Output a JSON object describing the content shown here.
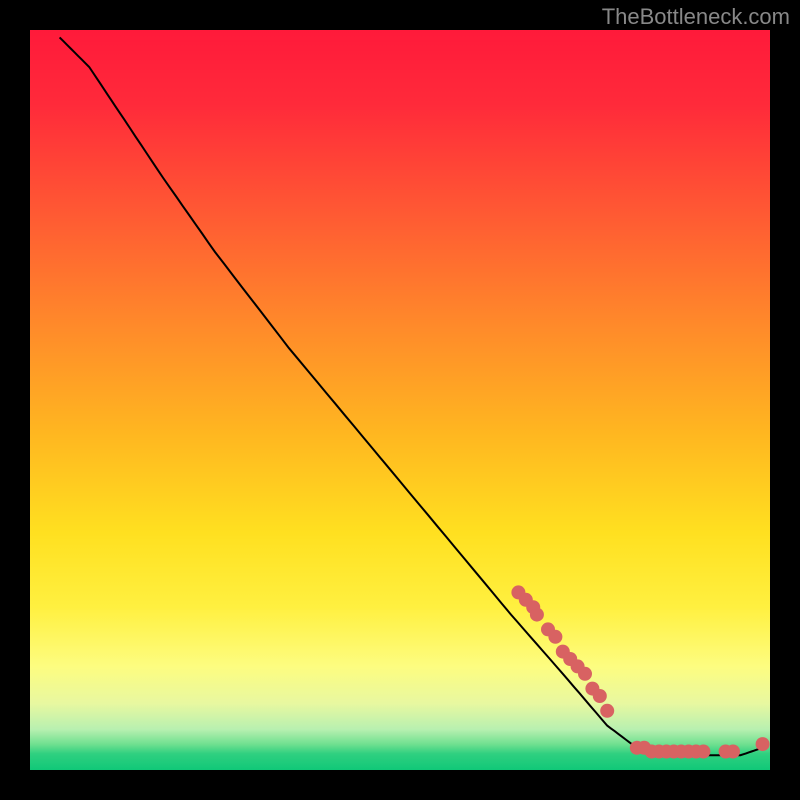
{
  "watermark": "TheBottleneck.com",
  "chart_data": {
    "type": "line",
    "title": "",
    "xlabel": "",
    "ylabel": "",
    "xlim": [
      0,
      100
    ],
    "ylim": [
      0,
      100
    ],
    "line_series": {
      "name": "curve",
      "x": [
        4,
        8,
        12,
        18,
        25,
        35,
        45,
        55,
        65,
        72,
        78,
        82,
        85,
        88,
        92,
        96,
        99
      ],
      "y": [
        99,
        95,
        89,
        80,
        70,
        57,
        45,
        33,
        21,
        13,
        6,
        3,
        2,
        2,
        2,
        2,
        3
      ]
    },
    "marker_series": {
      "name": "points",
      "x": [
        66,
        67,
        68,
        68.5,
        70,
        71,
        72,
        73,
        74,
        75,
        76,
        77,
        78,
        82,
        83,
        84,
        85,
        86,
        87,
        88,
        89,
        90,
        91,
        94,
        95,
        99
      ],
      "y": [
        24,
        23,
        22,
        21,
        19,
        18,
        16,
        15,
        14,
        13,
        11,
        10,
        8,
        3,
        3,
        2.5,
        2.5,
        2.5,
        2.5,
        2.5,
        2.5,
        2.5,
        2.5,
        2.5,
        2.5,
        3.5
      ]
    },
    "gradient_bands": [
      {
        "offset": 0.0,
        "color": "#ff1a3a"
      },
      {
        "offset": 0.1,
        "color": "#ff2a3a"
      },
      {
        "offset": 0.25,
        "color": "#ff5a33"
      },
      {
        "offset": 0.4,
        "color": "#ff8a2a"
      },
      {
        "offset": 0.55,
        "color": "#ffb820"
      },
      {
        "offset": 0.68,
        "color": "#ffe020"
      },
      {
        "offset": 0.78,
        "color": "#fff040"
      },
      {
        "offset": 0.86,
        "color": "#fdfd80"
      },
      {
        "offset": 0.91,
        "color": "#e8f8a0"
      },
      {
        "offset": 0.945,
        "color": "#b8f0b0"
      },
      {
        "offset": 0.965,
        "color": "#70e090"
      },
      {
        "offset": 0.978,
        "color": "#30d080"
      },
      {
        "offset": 1.0,
        "color": "#10c878"
      }
    ],
    "marker_color": "#d86262",
    "line_color": "#000000"
  }
}
